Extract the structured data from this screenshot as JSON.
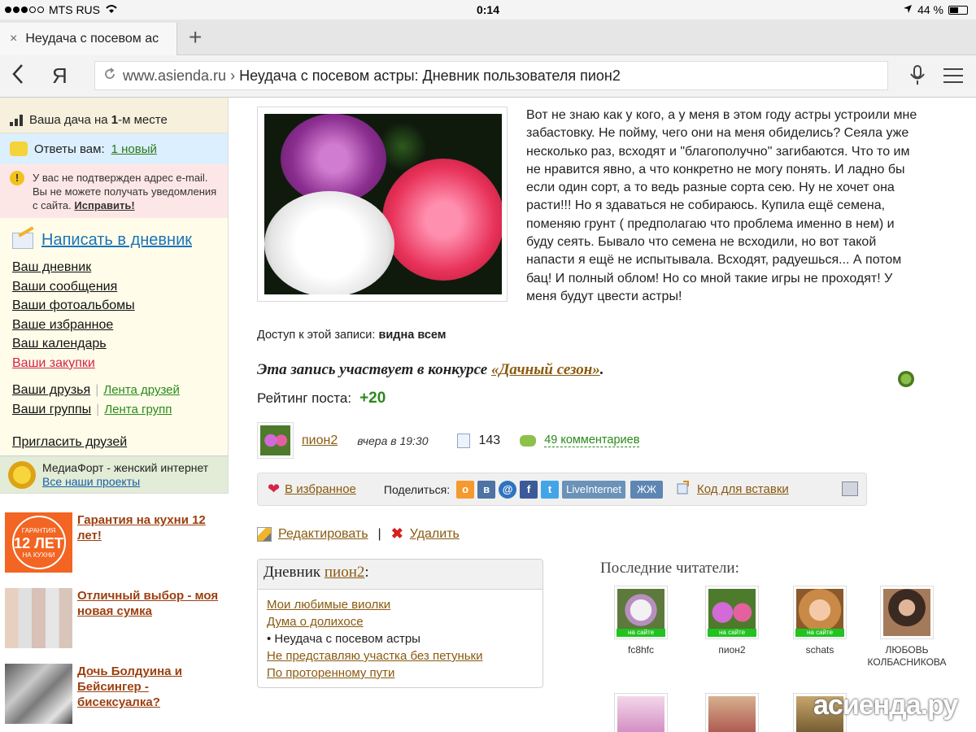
{
  "status": {
    "carrier": "MTS RUS",
    "time": "0:14",
    "battery": "44 %",
    "battery_level": 0.44
  },
  "tab": {
    "title": "Неудача с посевом ас",
    "close": "×",
    "new": "+"
  },
  "address": {
    "domain": "www.asienda.ru",
    "separator": "›",
    "page_title": "Неудача с посевом астры: Дневник пользователя пион2",
    "yandex": "Я"
  },
  "sidebar": {
    "place_prefix": "Ваша дача на ",
    "place_num": "1",
    "place_suffix": "-м месте",
    "answers_label": "Ответы вам:",
    "answers_link": "1 новый",
    "warning_text": "У вас не подтвержден адрес e-mail. Вы не можете получать уведомления с сайта.",
    "warning_link": "Исправить!",
    "write_link": "Написать в дневник",
    "links": [
      "Ваш дневник",
      "Ваши сообщения",
      "Ваши фотоальбомы",
      "Ваше избранное",
      "Ваш календарь",
      "Ваши закупки"
    ],
    "friends": "Ваши друзья",
    "friends_feed": "Лента друзей",
    "groups": "Ваши группы",
    "groups_feed": "Лента групп",
    "invite": "Пригласить друзей",
    "media_text": "МедиаФорт - женский интернет",
    "media_link": "Все наши проекты"
  },
  "ads": [
    {
      "title": "Гарантия на кухни 12 лет!",
      "badge_top": "ГАРАНТИЯ",
      "badge_big": "12 ЛЕТ",
      "badge_bottom": "НА КУХНИ"
    },
    {
      "title": "Отличный выбор - моя новая сумка"
    },
    {
      "title": "Дочь Болдуина и Бейсингер - бисексуалка?"
    }
  ],
  "post": {
    "text": "Вот не знаю как у кого, а у меня в этом году астры устроили мне забастовку. Не пойму, чего они на меня обиделись? Сеяла уже несколько раз, всходят и \"благополучно\" загибаются. Что то им не нравится явно, а что конкретно не могу понять. И ладно бы если один сорт, а то ведь разные сорта сею. Ну не хочет она расти!!! Но я здаваться не собираюсь. Купила ещё семена, поменяю грунт ( предполагаю что проблема именно в нем) и буду сеять. Бывало что семена не всходили, но вот такой напасти я ещё не испытывала. Всходят, радуешься... А потом бац! И полный облом! Но со мной такие игры не проходят! У меня будут цвести астры!",
    "access_label": "Доступ к этой записи:",
    "access_value": "видна всем",
    "contest_text": "Эта запись участвует в конкурсе ",
    "contest_link": "«Дачный сезон»",
    "rating_label": "Рейтинг поста:",
    "rating_value": "+20",
    "author": "пион2",
    "when": "вчера в 19:30",
    "views": "143",
    "comments": "49 комментариев"
  },
  "actions": {
    "favorite": "В избранное",
    "share_label": "Поделиться:",
    "ok": "о",
    "vk": "в",
    "mail": "@",
    "fb": "f",
    "tw": "t",
    "liveinternet": "LiveInternet",
    "lj": "ЖЖ",
    "embed": "Код для вставки",
    "edit": "Редактировать",
    "delete": "Удалить",
    "pipe": "|"
  },
  "diary": {
    "title_prefix": "Дневник ",
    "title_name": "пион2",
    "title_suffix": ":",
    "items": [
      "Мои любимые виолки",
      "Дума о долихосе"
    ],
    "current": "• Неудача с посевом астры",
    "items2": [
      "Не представляю участка без петуньки",
      "По проторенному пути"
    ]
  },
  "readers": {
    "title": "Последние читатели:",
    "online_label": "на сайте",
    "list": [
      {
        "name": "fc8hfc",
        "online": true
      },
      {
        "name": "пион2",
        "online": true
      },
      {
        "name": "schats",
        "online": true
      },
      {
        "name": "ЛЮБОВЬ КОЛБАСНИКОВА",
        "online": false
      }
    ]
  },
  "watermark": "асиенда.ру",
  "colors": {
    "accent_link": "#8a5a0f",
    "green": "#2a8a1a",
    "blue_link": "#1a73b8",
    "online": "#21c321"
  }
}
